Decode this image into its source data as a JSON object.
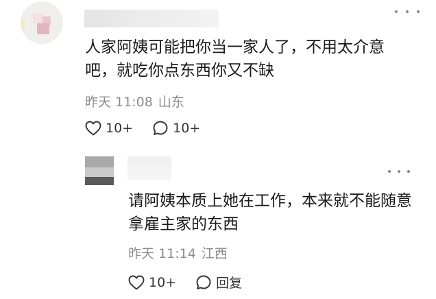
{
  "comments": [
    {
      "text": "人家阿姨可能把你当一家人了，不用太介意吧，就吃你点东西你又不缺",
      "time": "昨天 11:08",
      "location": "山东",
      "likes": "10+",
      "replies_count": "10+",
      "icons": {
        "like": "heart-outline-icon",
        "comment": "speech-bubble-icon",
        "more": "more-dots-icon"
      }
    }
  ],
  "reply": {
    "text": "请阿姨本质上她在工作，本来就不能随意拿雇主家的东西",
    "time": "昨天 11:14",
    "location": "江西",
    "likes": "10+",
    "reply_label": "回复"
  },
  "colors": {
    "meta_gray": "#8c8c8c",
    "text_dark": "#1a1a1a",
    "blur_gray": "#e4e4e4"
  }
}
